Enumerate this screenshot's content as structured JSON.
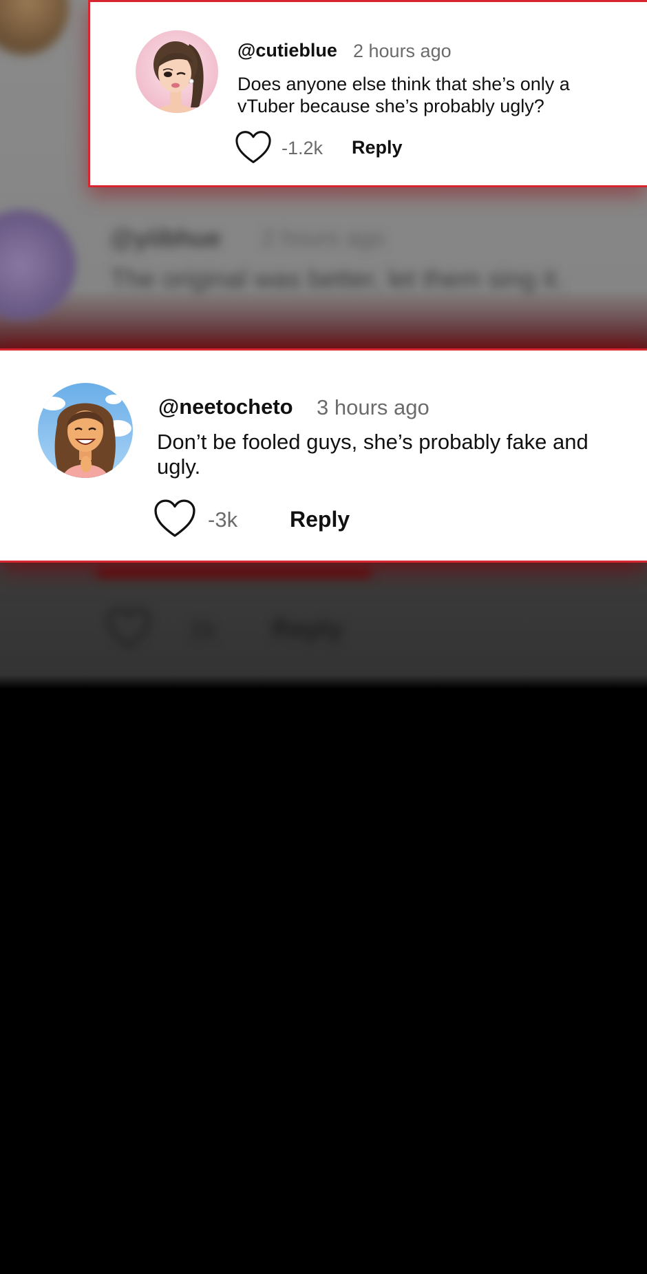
{
  "background": {
    "blurred_comment": {
      "username": "@yiibhue",
      "timestamp": "2 hours ago",
      "text": "The original was better, let them sing it."
    }
  },
  "comments": [
    {
      "username": "@cutieblue",
      "timestamp": "2 hours ago",
      "text": "Does anyone else think that she’s only a vTuber because she’s probably ugly?",
      "likes": "-1.2k",
      "reply_label": "Reply",
      "avatar_icon": "cartoon-girl-ponytail-avatar",
      "highlight_color": "#d7262f"
    },
    {
      "username": "@neetocheto",
      "timestamp": "3 hours ago",
      "text": "Don’t be fooled guys, she’s probably fake and ugly.",
      "likes": "-3k",
      "reply_label": "Reply",
      "avatar_icon": "cartoon-girl-long-hair-avatar",
      "highlight_color": "#d7262f"
    }
  ]
}
